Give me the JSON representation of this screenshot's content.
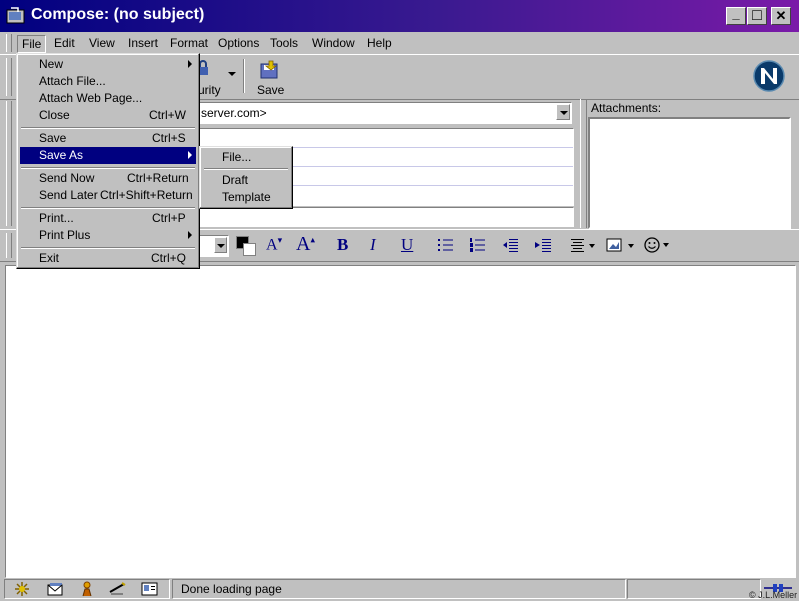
{
  "window": {
    "title": "Compose: (no subject)",
    "minimize": "_",
    "maximize": "□",
    "close": "✕"
  },
  "menubar": [
    "File",
    "Edit",
    "View",
    "Insert",
    "Format",
    "Options",
    "Tools",
    "Window",
    "Help"
  ],
  "file_menu": {
    "items": [
      {
        "label": "New",
        "shortcut": "",
        "submenu": true
      },
      {
        "label": "Attach File...",
        "shortcut": ""
      },
      {
        "label": "Attach Web Page...",
        "shortcut": ""
      },
      {
        "label": "Close",
        "shortcut": "Ctrl+W"
      },
      {
        "label": "Save",
        "shortcut": "Ctrl+S"
      },
      {
        "label": "Save As",
        "shortcut": "",
        "submenu": true,
        "highlighted": true
      },
      {
        "label": "Send Now",
        "shortcut": "Ctrl+Return"
      },
      {
        "label": "Send Later",
        "shortcut": "Ctrl+Shift+Return"
      },
      {
        "label": "Print...",
        "shortcut": "Ctrl+P"
      },
      {
        "label": "Print Plus",
        "shortcut": "",
        "submenu": true
      },
      {
        "label": "Exit",
        "shortcut": "Ctrl+Q"
      }
    ]
  },
  "saveas_submenu": [
    "File...",
    "Draft",
    "Template"
  ],
  "toolbar": {
    "security_label": "urity",
    "save_label": "Save"
  },
  "address": {
    "from_value": "server.com>"
  },
  "attachments": {
    "label": "Attachments:"
  },
  "format_toolbar": {
    "bold": "B",
    "italic": "I",
    "underline": "U"
  },
  "status": {
    "text": "Done loading page",
    "watermark": "© J.L.Meller"
  },
  "colors": {
    "title_start": "#000080",
    "title_end": "#7a1aa8",
    "highlight": "#000080",
    "chrome": "#c0c0c0"
  }
}
